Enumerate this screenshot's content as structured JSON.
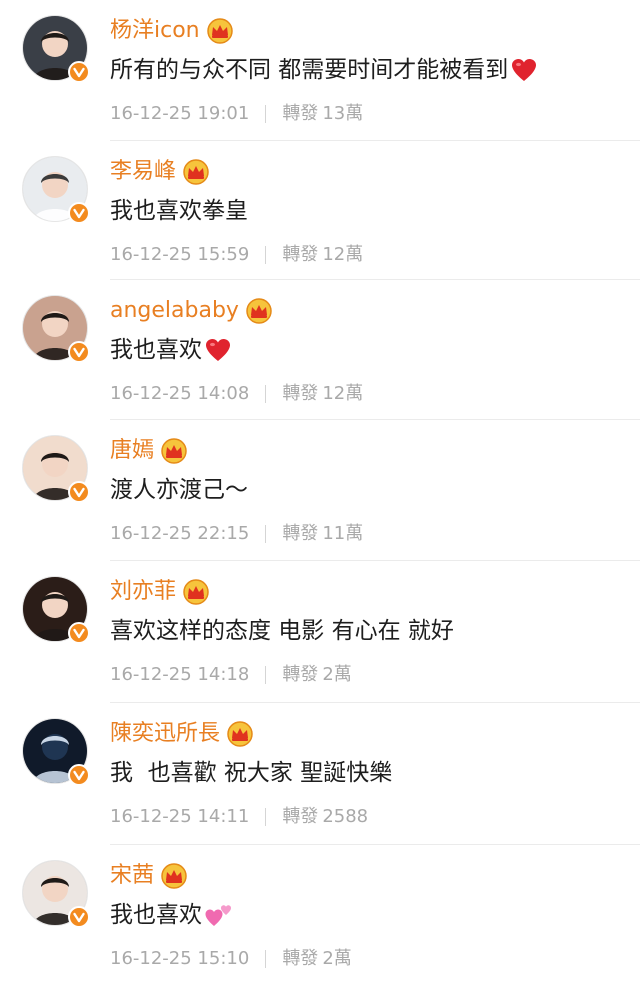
{
  "comments": [
    {
      "username": "杨洋icon",
      "text": "所有的与众不同 都需要时间才能被看到",
      "emoji": "red-heart",
      "timestamp": "16-12-25 19:01",
      "repost_label": "轉發",
      "repost_count": "13萬",
      "avatar_color": "#3a3f47"
    },
    {
      "username": "李易峰",
      "text": "我也喜欢拳皇",
      "emoji": "",
      "timestamp": "16-12-25 15:59",
      "repost_label": "轉發",
      "repost_count": "12萬",
      "avatar_color": "#e9ecef"
    },
    {
      "username": "angelababy",
      "text": "我也喜欢",
      "emoji": "red-heart",
      "timestamp": "16-12-25 14:08",
      "repost_label": "轉發",
      "repost_count": "12萬",
      "avatar_color": "#c9a28f"
    },
    {
      "username": "唐嫣",
      "text": "渡人亦渡己～",
      "emoji": "",
      "timestamp": "16-12-25 22:15",
      "repost_label": "轉發",
      "repost_count": "11萬",
      "avatar_color": "#f1dccd"
    },
    {
      "username": "刘亦菲",
      "text": "喜欢这样的态度 电影 有心在 就好",
      "emoji": "",
      "timestamp": "16-12-25 14:18",
      "repost_label": "轉發",
      "repost_count": "2萬",
      "avatar_color": "#2b1d18"
    },
    {
      "username": "陳奕迅所長",
      "text": "我  也喜歡 祝大家 聖誕快樂",
      "emoji": "",
      "timestamp": "16-12-25 14:11",
      "repost_label": "轉發",
      "repost_count": "2588",
      "avatar_color": "#101a2a"
    },
    {
      "username": "宋茜",
      "text": "我也喜欢",
      "emoji": "pink-hearts",
      "timestamp": "16-12-25 15:10",
      "repost_label": "轉發",
      "repost_count": "2萬",
      "avatar_color": "#ece6e2"
    }
  ],
  "colors": {
    "username": "#e87f22",
    "text": "#1e1e1e",
    "meta": "#a9a9a9",
    "verified_badge": "#f38b1f",
    "crown": "#f0a82a",
    "heart": "#e0232e",
    "pink_heart": "#f06ab0"
  },
  "icons": {
    "verified": "verified-v-icon",
    "crown": "vip-crown-icon",
    "heart": "red-heart-icon",
    "pink_hearts": "pink-hearts-icon"
  }
}
